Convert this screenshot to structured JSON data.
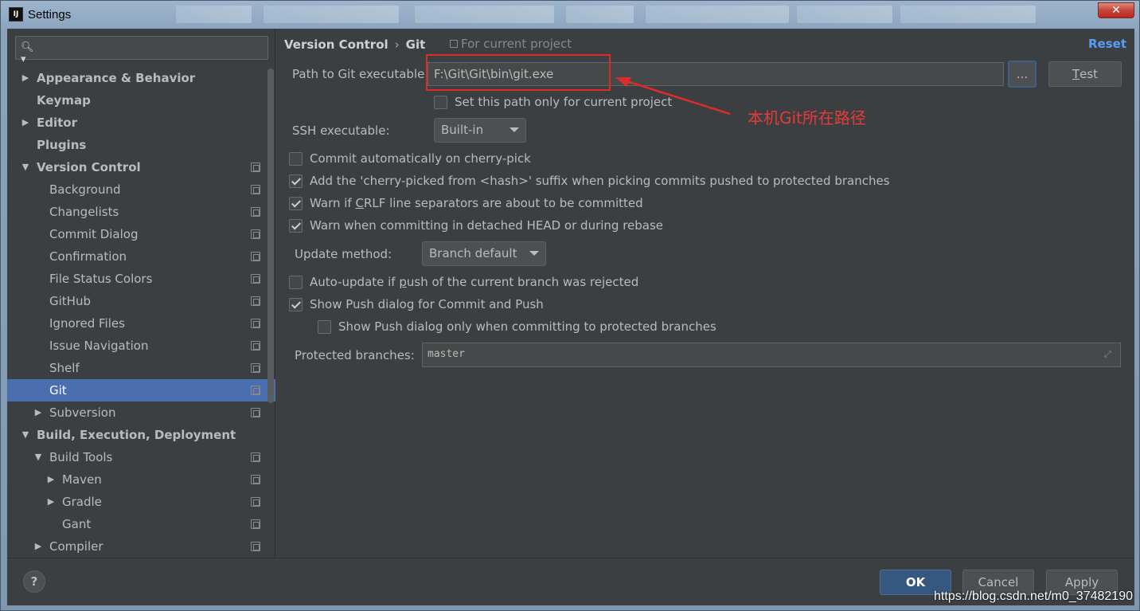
{
  "window": {
    "title": "Settings",
    "app_icon": "IJ"
  },
  "search": {
    "placeholder": ""
  },
  "sidebar": {
    "items": [
      {
        "label": "Appearance & Behavior",
        "level": 0,
        "arrow": "right",
        "bold": true,
        "project": false
      },
      {
        "label": "Keymap",
        "level": 0,
        "arrow": "",
        "bold": true,
        "project": false
      },
      {
        "label": "Editor",
        "level": 0,
        "arrow": "right",
        "bold": true,
        "project": false
      },
      {
        "label": "Plugins",
        "level": 0,
        "arrow": "",
        "bold": true,
        "project": false
      },
      {
        "label": "Version Control",
        "level": 0,
        "arrow": "down",
        "bold": true,
        "project": true
      },
      {
        "label": "Background",
        "level": 1,
        "arrow": "",
        "bold": false,
        "project": true
      },
      {
        "label": "Changelists",
        "level": 1,
        "arrow": "",
        "bold": false,
        "project": true
      },
      {
        "label": "Commit Dialog",
        "level": 1,
        "arrow": "",
        "bold": false,
        "project": true
      },
      {
        "label": "Confirmation",
        "level": 1,
        "arrow": "",
        "bold": false,
        "project": true
      },
      {
        "label": "File Status Colors",
        "level": 1,
        "arrow": "",
        "bold": false,
        "project": true
      },
      {
        "label": "GitHub",
        "level": 1,
        "arrow": "",
        "bold": false,
        "project": true
      },
      {
        "label": "Ignored Files",
        "level": 1,
        "arrow": "",
        "bold": false,
        "project": true
      },
      {
        "label": "Issue Navigation",
        "level": 1,
        "arrow": "",
        "bold": false,
        "project": true
      },
      {
        "label": "Shelf",
        "level": 1,
        "arrow": "",
        "bold": false,
        "project": true
      },
      {
        "label": "Git",
        "level": 1,
        "arrow": "",
        "bold": false,
        "project": true,
        "selected": true
      },
      {
        "label": "Subversion",
        "level": 1,
        "arrow": "right",
        "bold": false,
        "project": true
      },
      {
        "label": "Build, Execution, Deployment",
        "level": 0,
        "arrow": "down",
        "bold": true,
        "project": false
      },
      {
        "label": "Build Tools",
        "level": 1,
        "arrow": "down",
        "bold": false,
        "project": true
      },
      {
        "label": "Maven",
        "level": 2,
        "arrow": "right",
        "bold": false,
        "project": true
      },
      {
        "label": "Gradle",
        "level": 2,
        "arrow": "right",
        "bold": false,
        "project": true
      },
      {
        "label": "Gant",
        "level": 2,
        "arrow": "",
        "bold": false,
        "project": true
      },
      {
        "label": "Compiler",
        "level": 1,
        "arrow": "right",
        "bold": false,
        "project": true
      }
    ]
  },
  "header": {
    "crumb1": "Version Control",
    "crumb_sep": "›",
    "crumb2": "Git",
    "for_project": "For current project",
    "reset": "Reset"
  },
  "git": {
    "path_label": "Path to Git executable:",
    "path_value": "F:\\Git\\Git\\bin\\git.exe",
    "browse_label": "...",
    "test_label_u": "T",
    "test_label_rest": "est",
    "set_path_only": "Set this path only for current project",
    "ssh_label": "SSH executable:",
    "ssh_value": "Built-in",
    "commit_auto": "Commit automatically on cherry-pick",
    "cherry_suffix": "Add the 'cherry-picked from <hash>' suffix when picking commits pushed to protected branches",
    "warn_crlf_pre": "Warn if ",
    "warn_crlf_u": "C",
    "warn_crlf_post": "RLF line separators are about to be committed",
    "warn_detached": "Warn when committing in detached HEAD or during rebase",
    "update_label": "Update method:",
    "update_value": "Branch default",
    "auto_update_pre": "Auto-update if ",
    "auto_update_u": "p",
    "auto_update_post": "ush of the current branch was rejected",
    "show_push": "Show Push dialog for Commit and Push",
    "show_push_protected": "Show Push dialog only when committing to protected branches",
    "protected_label": "Protected branches:",
    "protected_value": "master"
  },
  "annotation": {
    "text": "本机Git所在路径",
    "color": "#e02a2a"
  },
  "footer": {
    "help": "?",
    "ok": "OK",
    "cancel": "Cancel",
    "apply": "Apply"
  },
  "watermark": "https://blog.csdn.net/m0_37482190",
  "colors": {
    "accent": "#4b6eaf",
    "link": "#589df6",
    "background": "#3c3f41"
  }
}
